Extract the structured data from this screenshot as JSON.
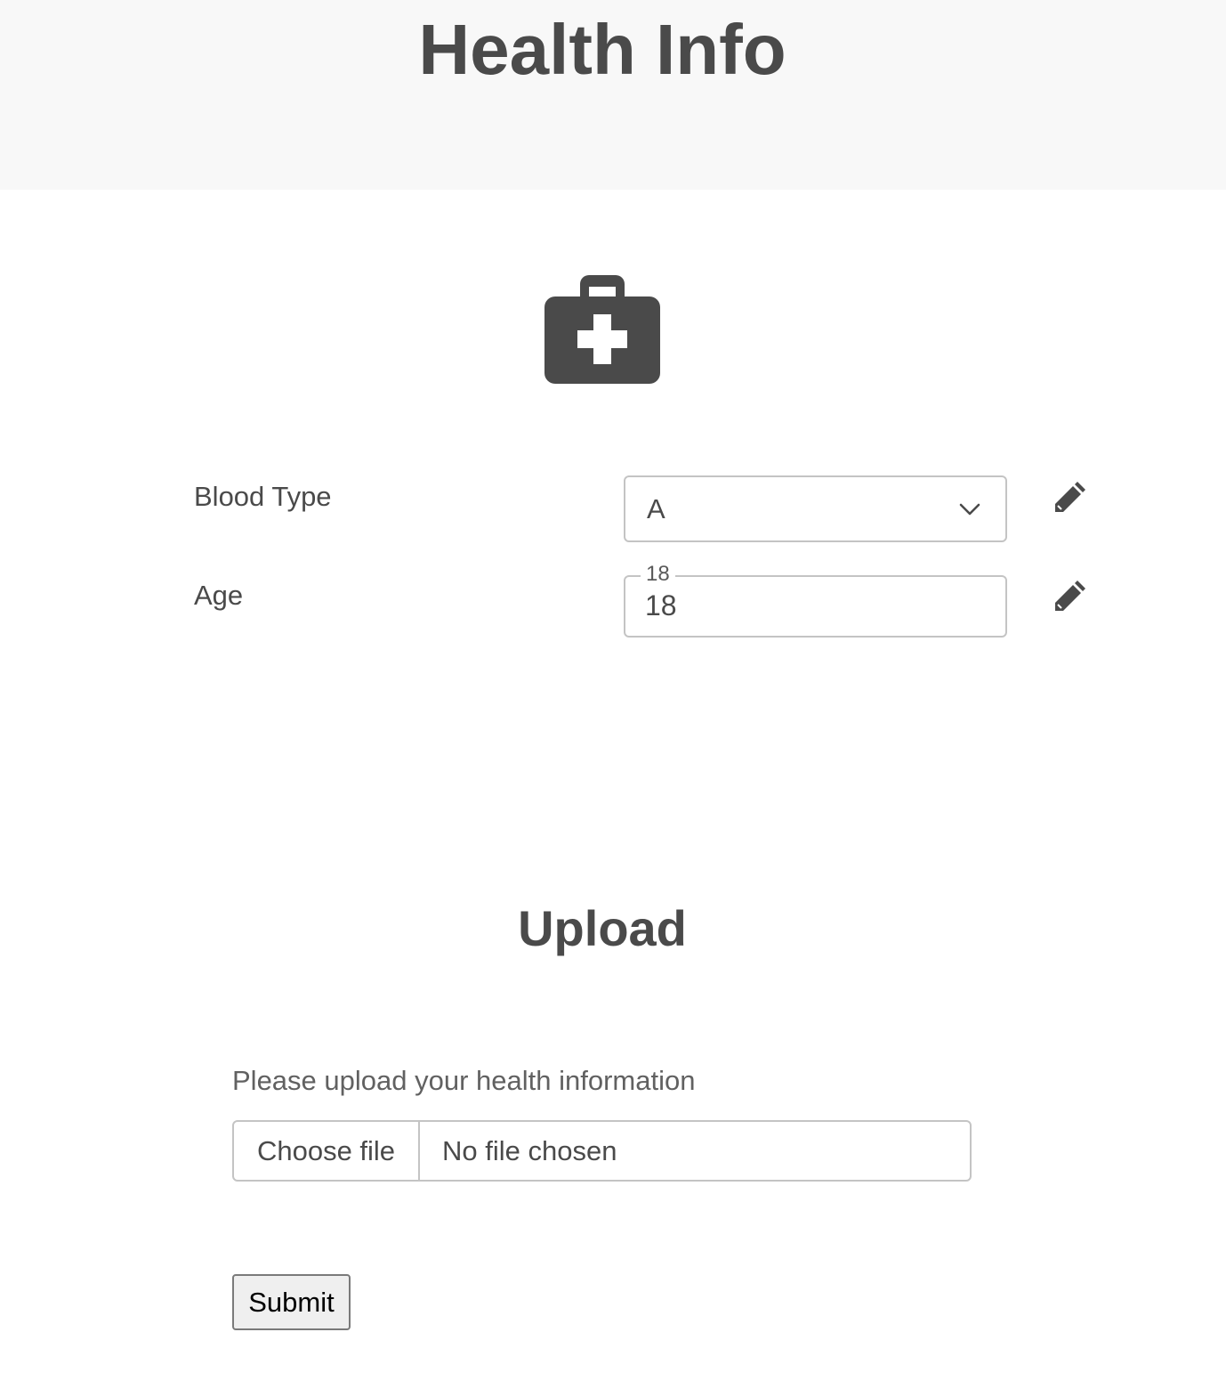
{
  "header": {
    "title": "Health Info"
  },
  "icons": {
    "hero": "medical-kit-icon",
    "edit": "pencil-icon",
    "dropdown": "chevron-down-icon"
  },
  "form": {
    "blood_type": {
      "label": "Blood Type",
      "value": "A"
    },
    "age": {
      "label": "Age",
      "floating_label": "18",
      "value": "18"
    }
  },
  "upload": {
    "title": "Upload",
    "hint": "Please upload your health information",
    "choose_label": "Choose file",
    "status": "No file chosen",
    "submit_label": "Submit"
  },
  "colors": {
    "text": "#4a4a4a",
    "header_bg": "#f8f8f8",
    "border": "#c4c4c4"
  }
}
